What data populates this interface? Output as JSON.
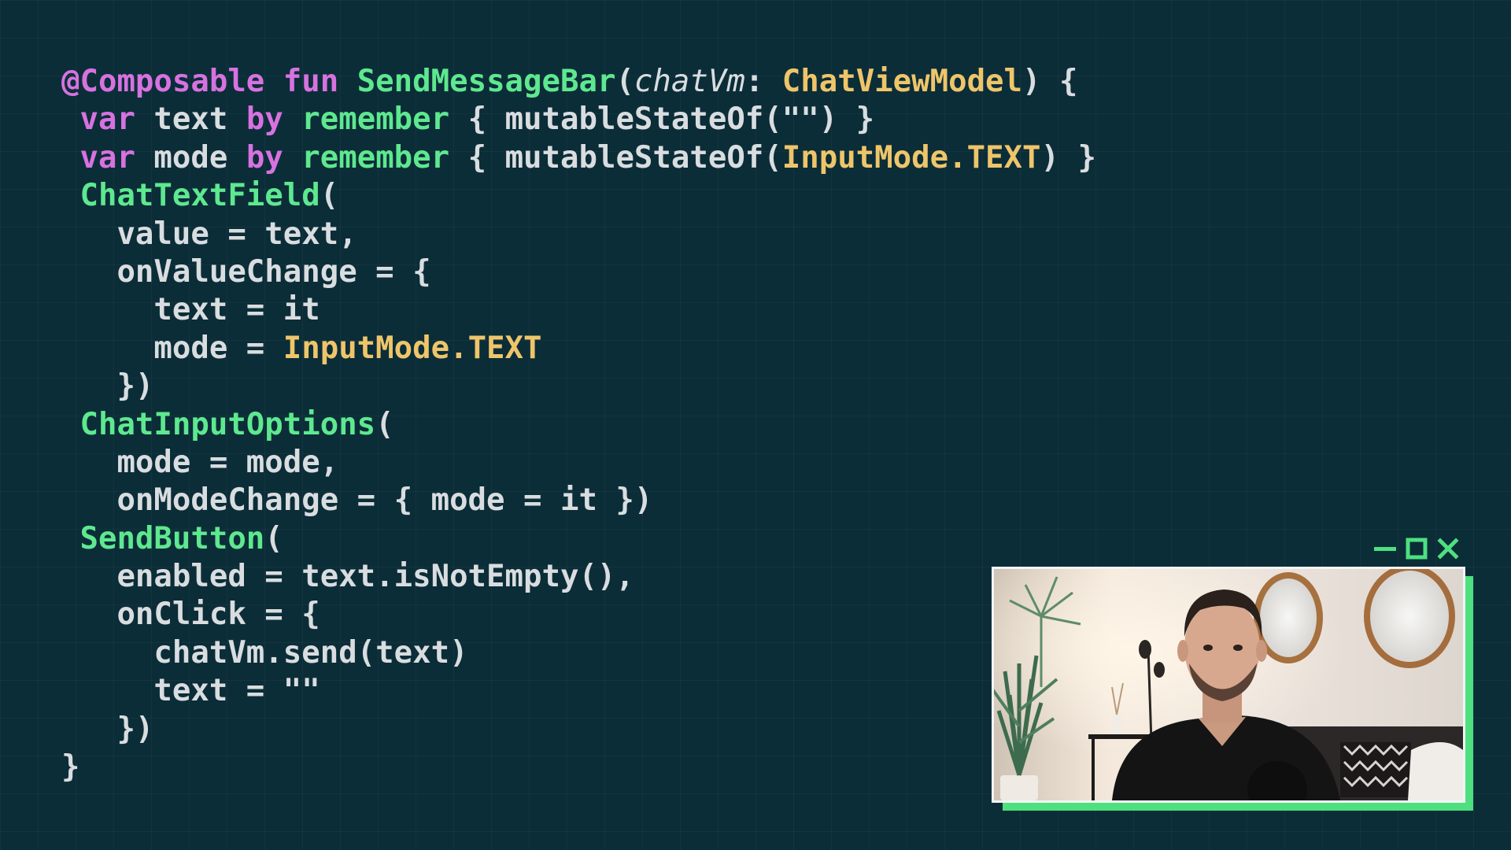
{
  "editor": {
    "lines": [
      [
        {
          "t": "@Composable",
          "c": "ann"
        },
        {
          "t": " ",
          "c": "plain"
        },
        {
          "t": "fun",
          "c": "kw"
        },
        {
          "t": " ",
          "c": "plain"
        },
        {
          "t": "SendMessageBar",
          "c": "fn"
        },
        {
          "t": "(",
          "c": "plain"
        },
        {
          "t": "chatVm",
          "c": "param"
        },
        {
          "t": ": ",
          "c": "plain"
        },
        {
          "t": "ChatViewModel",
          "c": "type"
        },
        {
          "t": ") {",
          "c": "plain"
        }
      ],
      [
        {
          "t": " ",
          "c": "plain"
        },
        {
          "t": "var",
          "c": "kw"
        },
        {
          "t": " text ",
          "c": "plain"
        },
        {
          "t": "by",
          "c": "kw"
        },
        {
          "t": " ",
          "c": "plain"
        },
        {
          "t": "remember",
          "c": "fn"
        },
        {
          "t": " { mutableStateOf(\"\") }",
          "c": "plain"
        }
      ],
      [
        {
          "t": " ",
          "c": "plain"
        },
        {
          "t": "var",
          "c": "kw"
        },
        {
          "t": " mode ",
          "c": "plain"
        },
        {
          "t": "by",
          "c": "kw"
        },
        {
          "t": " ",
          "c": "plain"
        },
        {
          "t": "remember",
          "c": "fn"
        },
        {
          "t": " { mutableStateOf(",
          "c": "plain"
        },
        {
          "t": "InputMode.TEXT",
          "c": "type"
        },
        {
          "t": ") }",
          "c": "plain"
        }
      ],
      [
        {
          "t": " ",
          "c": "plain"
        },
        {
          "t": "ChatTextField",
          "c": "fn"
        },
        {
          "t": "(",
          "c": "plain"
        }
      ],
      [
        {
          "t": "   value = text,",
          "c": "plain"
        }
      ],
      [
        {
          "t": "   onValueChange = {",
          "c": "plain"
        }
      ],
      [
        {
          "t": "     text = it",
          "c": "plain"
        }
      ],
      [
        {
          "t": "     mode = ",
          "c": "plain"
        },
        {
          "t": "InputMode.TEXT",
          "c": "type"
        }
      ],
      [
        {
          "t": "   })",
          "c": "plain"
        }
      ],
      [
        {
          "t": " ",
          "c": "plain"
        },
        {
          "t": "ChatInputOptions",
          "c": "fn"
        },
        {
          "t": "(",
          "c": "plain"
        }
      ],
      [
        {
          "t": "   mode = mode,",
          "c": "plain"
        }
      ],
      [
        {
          "t": "   onModeChange = { mode = it })",
          "c": "plain"
        }
      ],
      [
        {
          "t": " ",
          "c": "plain"
        },
        {
          "t": "SendButton",
          "c": "fn"
        },
        {
          "t": "(",
          "c": "plain"
        }
      ],
      [
        {
          "t": "   enabled = text.isNotEmpty(),",
          "c": "plain"
        }
      ],
      [
        {
          "t": "   onClick = {",
          "c": "plain"
        }
      ],
      [
        {
          "t": "     chatVm.send(text)",
          "c": "plain"
        }
      ],
      [
        {
          "t": "     text = \"\"",
          "c": "plain"
        }
      ],
      [
        {
          "t": "   })",
          "c": "plain"
        }
      ],
      [
        {
          "t": "}",
          "c": "plain"
        }
      ]
    ]
  },
  "pip": {
    "controls": [
      {
        "name": "minimize",
        "icon": "minimize-icon"
      },
      {
        "name": "maximize",
        "icon": "maximize-icon"
      },
      {
        "name": "close",
        "icon": "close-icon"
      }
    ],
    "accent": "#4ee07f"
  },
  "colors": {
    "background": "#0b2d38",
    "text": "#d9dde0",
    "keyword": "#d772e0",
    "function": "#5ee88f",
    "type": "#efc56a",
    "accent": "#4ee07f"
  }
}
